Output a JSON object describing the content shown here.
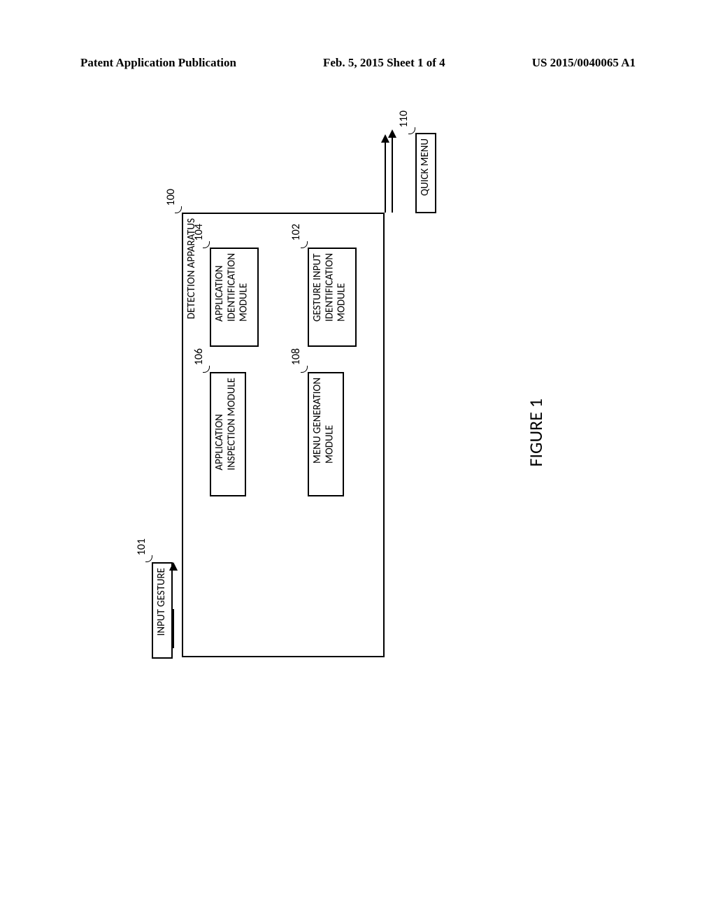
{
  "header": {
    "left": "Patent Application Publication",
    "center": "Feb. 5, 2015  Sheet 1 of 4",
    "right": "US 2015/0040065 A1"
  },
  "figure_caption": "FIGURE 1",
  "refs": {
    "r100": "100",
    "r101": "101",
    "r102": "102",
    "r104": "104",
    "r106": "106",
    "r108": "108",
    "r110": "110"
  },
  "boxes": {
    "detection_apparatus": "DETECTION APPARATUS",
    "application_identification": "APPLICATION\nIDENTIFICATION\nMODULE",
    "gesture_input": "GESTURE INPUT\nIDENTIFICATION\nMODULE",
    "application_inspection": "APPLICATION\nINSPECTION MODULE",
    "menu_generation": "MENU GENERATION\nMODULE",
    "input_gesture": "INPUT GESTURE",
    "quick_menu": "QUICK MENU"
  }
}
